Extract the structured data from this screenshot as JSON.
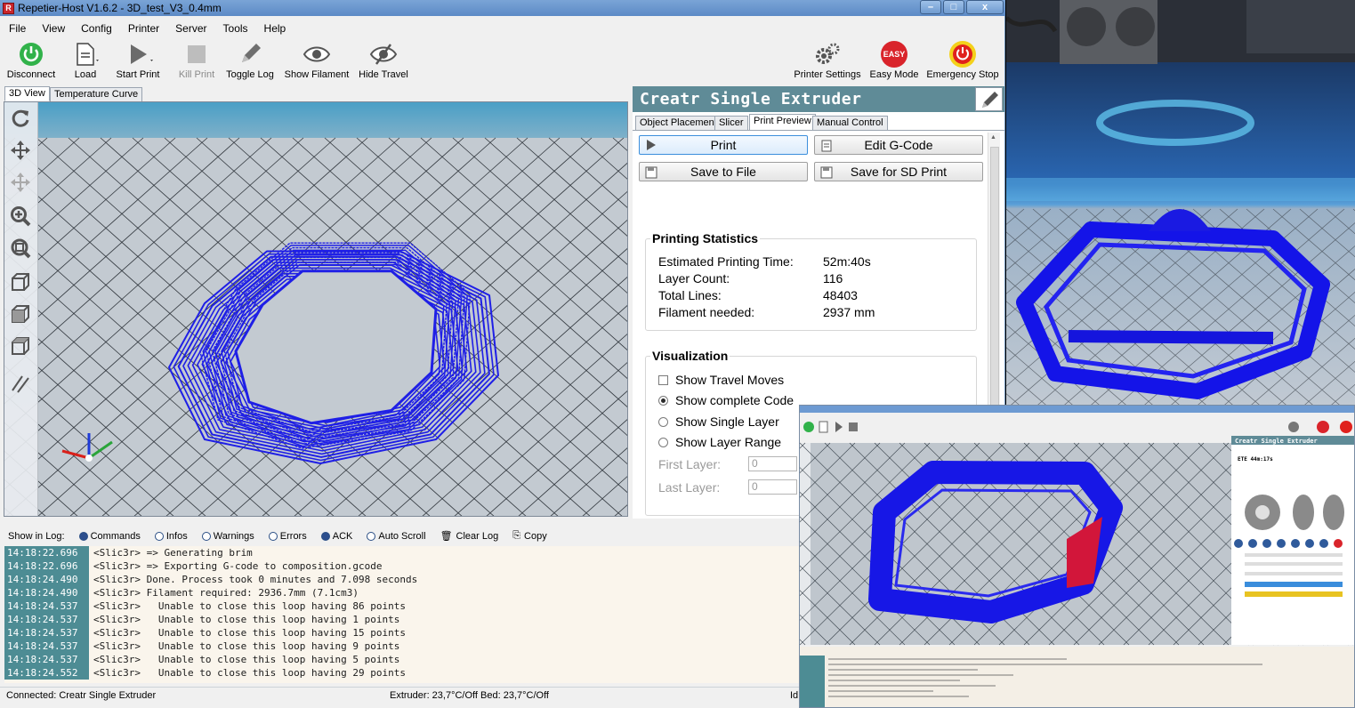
{
  "window": {
    "title": "Repetier-Host V1.6.2 - 3D_test_V3_0.4mm",
    "app_icon_letter": "R",
    "controls": [
      "–",
      "□",
      "x"
    ]
  },
  "menu": [
    "File",
    "View",
    "Config",
    "Printer",
    "Server",
    "Tools",
    "Help"
  ],
  "toolbar": {
    "disconnect": "Disconnect",
    "load": "Load",
    "start_print": "Start Print",
    "kill_print": "Kill Print",
    "toggle_log": "Toggle Log",
    "show_filament": "Show Filament",
    "hide_travel": "Hide Travel",
    "printer_settings": "Printer Settings",
    "easy_mode": "Easy Mode",
    "easy_badge": "EASY",
    "emergency_stop": "Emergency Stop"
  },
  "left_tabs": [
    "3D View",
    "Temperature Curve"
  ],
  "printer_name": "Creatr Single Extruder",
  "right_tabs": [
    "Object Placement",
    "Slicer",
    "Print Preview",
    "Manual Control"
  ],
  "buttons": {
    "print": "Print",
    "edit_gcode": "Edit G-Code",
    "save_file": "Save to File",
    "save_sd": "Save for SD Print"
  },
  "stats": {
    "title": "Printing Statistics",
    "rows": [
      {
        "label": "Estimated Printing Time:",
        "value": "52m:40s"
      },
      {
        "label": "Layer Count:",
        "value": "116"
      },
      {
        "label": "Total Lines:",
        "value": "48403"
      },
      {
        "label": "Filament needed:",
        "value": "2937 mm"
      }
    ]
  },
  "visualization": {
    "title": "Visualization",
    "show_travel": "Show Travel Moves",
    "options": [
      "Show complete Code",
      "Show Single Layer",
      "Show Layer Range"
    ],
    "selected": 0,
    "first_layer": {
      "label": "First Layer:",
      "value": "0"
    },
    "last_layer": {
      "label": "Last Layer:",
      "value": "0"
    }
  },
  "log_bar": {
    "label": "Show in Log:",
    "options": [
      {
        "label": "Commands",
        "on": true
      },
      {
        "label": "Infos",
        "on": false
      },
      {
        "label": "Warnings",
        "on": false
      },
      {
        "label": "Errors",
        "on": false
      },
      {
        "label": "ACK",
        "on": true
      },
      {
        "label": "Auto Scroll",
        "on": false
      }
    ],
    "clear": "Clear Log",
    "copy": "Copy"
  },
  "log": [
    {
      "time": "14:18:22.696",
      "msg": "<Slic3r> => Generating brim"
    },
    {
      "time": "14:18:22.696",
      "msg": "<Slic3r> => Exporting G-code to composition.gcode"
    },
    {
      "time": "14:18:24.490",
      "msg": "<Slic3r> Done. Process took 0 minutes and 7.098 seconds"
    },
    {
      "time": "14:18:24.490",
      "msg": "<Slic3r> Filament required: 2936.7mm (7.1cm3)"
    },
    {
      "time": "14:18:24.537",
      "msg": "<Slic3r>   Unable to close this loop having 86 points"
    },
    {
      "time": "14:18:24.537",
      "msg": "<Slic3r>   Unable to close this loop having 1 points"
    },
    {
      "time": "14:18:24.537",
      "msg": "<Slic3r>   Unable to close this loop having 15 points"
    },
    {
      "time": "14:18:24.537",
      "msg": "<Slic3r>   Unable to close this loop having 9 points"
    },
    {
      "time": "14:18:24.537",
      "msg": "<Slic3r>   Unable to close this loop having 5 points"
    },
    {
      "time": "14:18:24.552",
      "msg": "<Slic3r>   Unable to close this loop having 29 points"
    }
  ],
  "status": {
    "connection": "Connected: Creatr Single Extruder",
    "temps": "Extruder: 23,7°C/Off Bed: 23,7°C/Off",
    "trailing": "Id"
  },
  "inset": {
    "printer_name": "Creatr Single Extruder",
    "eta": "ETE 44m:17s"
  },
  "colors": {
    "model_blue": "#1f1fe6",
    "grid_bg": "#b9c1ca",
    "header_teal": "#5f8b97",
    "log_time_bg": "#4d8c94",
    "connect_green": "#31b24a",
    "stop_red": "#e0211d"
  }
}
